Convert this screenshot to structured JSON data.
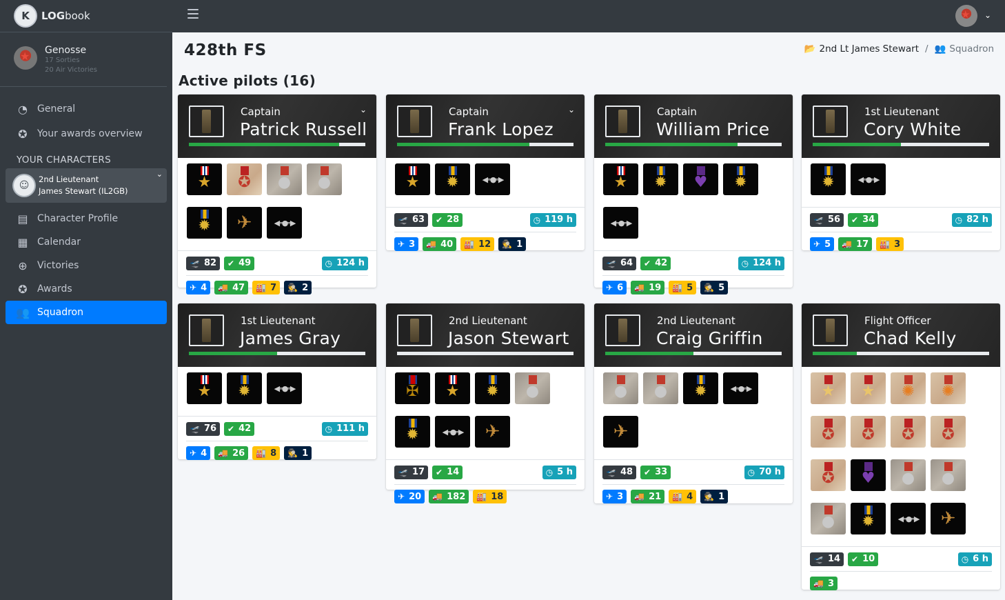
{
  "brand": {
    "bold": "LOG",
    "rest": "book",
    "logo_icon": "kl-logo-icon"
  },
  "user": {
    "name": "Genosse",
    "sorties": "17 Sorties",
    "victories": "20 Air Victories"
  },
  "nav": {
    "general": "General",
    "awards_overview": "Your awards overview",
    "characters_header": "YOUR CHARACTERS",
    "character_rank": "2nd Lieutenant",
    "character_name": "James Stewart (IL2GB)",
    "character_profile": "Character Profile",
    "calendar": "Calendar",
    "victories": "Victories",
    "awards": "Awards",
    "squadron": "Squadron"
  },
  "page": {
    "title": "428th FS",
    "section": "Active pilots (16)"
  },
  "breadcrumb": {
    "first": "2nd Lt James Stewart",
    "sep": "/",
    "second": "Squadron"
  },
  "colors": {
    "accent": "#007bff",
    "success": "#28a745",
    "info": "#17a2b8",
    "warning": "#ffc107",
    "navy": "#001f3f",
    "dark": "#343a40"
  },
  "pilots": [
    {
      "rank": "Captain",
      "name": "Patrick Russell",
      "progress": 0.85,
      "collapse": "double-chevron-down-icon",
      "medals": [
        "silver-star",
        "red-star",
        "combat-medal",
        "combat-medal",
        "air-medal",
        "eagle-wings",
        "pilot-wings"
      ],
      "sorties": "82",
      "success": "49",
      "hours": "124 h",
      "kills": "4",
      "ground": "47",
      "factory": "7",
      "crew": "2"
    },
    {
      "rank": "Captain",
      "name": "Frank Lopez",
      "progress": 0.75,
      "collapse": "chevron-down-icon",
      "medals": [
        "silver-star",
        "air-medal",
        "pilot-wings"
      ],
      "sorties": "63",
      "success": "28",
      "hours": "119 h",
      "kills": "3",
      "ground": "40",
      "factory": "12",
      "crew": "1"
    },
    {
      "rank": "Captain",
      "name": "William Price",
      "progress": 0.75,
      "medals": [
        "silver-star",
        "air-medal",
        "purple-heart",
        "air-medal",
        "pilot-wings"
      ],
      "sorties": "64",
      "success": "42",
      "hours": "124 h",
      "kills": "6",
      "ground": "19",
      "factory": "5",
      "crew": "5"
    },
    {
      "rank": "1st Lieutenant",
      "name": "Cory White",
      "progress": 0.5,
      "medals": [
        "air-medal",
        "pilot-wings"
      ],
      "sorties": "56",
      "success": "34",
      "hours": "82 h",
      "kills": "5",
      "ground": "17",
      "factory": "3"
    },
    {
      "rank": "1st Lieutenant",
      "name": "James Gray",
      "progress": 0.5,
      "medals": [
        "silver-star",
        "air-medal",
        "pilot-wings"
      ],
      "sorties": "76",
      "success": "42",
      "hours": "111 h",
      "kills": "4",
      "ground": "26",
      "factory": "8",
      "crew": "1"
    },
    {
      "rank": "2nd Lieutenant",
      "name": "Jason Stewart",
      "progress": 0.0,
      "medals": [
        "distinguished-cross",
        "silver-star",
        "air-medal",
        "combat-medal",
        "air-medal",
        "pilot-wings",
        "eagle-wings"
      ],
      "sorties": "17",
      "success": "14",
      "hours": "5 h",
      "kills": "20",
      "ground": "182",
      "factory": "18"
    },
    {
      "rank": "2nd Lieutenant",
      "name": "Craig Griffin",
      "progress": 0.5,
      "medals": [
        "combat-medal",
        "combat-medal",
        "air-medal",
        "pilot-wings",
        "eagle-wings"
      ],
      "sorties": "48",
      "success": "33",
      "hours": "70 h",
      "kills": "3",
      "ground": "21",
      "factory": "4",
      "crew": "1"
    },
    {
      "rank": "Flight Officer",
      "name": "Chad Kelly",
      "progress": 0.25,
      "medals": [
        "gold-star",
        "gold-star",
        "soviet-order",
        "soviet-order",
        "red-star",
        "red-star",
        "red-star",
        "red-star",
        "red-star",
        "purple-heart",
        "combat-medal",
        "combat-medal",
        "combat-medal",
        "air-medal",
        "pilot-wings",
        "eagle-wings"
      ],
      "sorties": "14",
      "success": "10",
      "hours": "6 h",
      "ground": "3"
    }
  ]
}
